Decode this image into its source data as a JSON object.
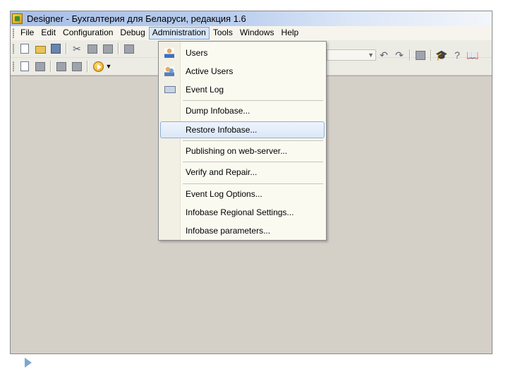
{
  "window": {
    "title": "Designer - Бухгалтерия для Беларуси, редакция 1.6",
    "app_icon": "1c-designer-icon"
  },
  "menubar": {
    "items": [
      {
        "label": "File"
      },
      {
        "label": "Edit"
      },
      {
        "label": "Configuration"
      },
      {
        "label": "Debug"
      },
      {
        "label": "Administration",
        "active": true
      },
      {
        "label": "Tools"
      },
      {
        "label": "Windows"
      },
      {
        "label": "Help"
      }
    ]
  },
  "administration_menu": {
    "items": [
      {
        "label": "Users",
        "icon": "user-icon"
      },
      {
        "label": "Active Users",
        "icon": "active-users-icon"
      },
      {
        "label": "Event Log",
        "icon": "event-log-icon"
      },
      {
        "label": "Dump Infobase..."
      },
      {
        "label": "Restore Infobase...",
        "highlighted": true
      },
      {
        "label": "Publishing on web-server..."
      },
      {
        "label": "Verify and Repair..."
      },
      {
        "label": "Event Log Options..."
      },
      {
        "label": "Infobase Regional Settings..."
      },
      {
        "label": "Infobase parameters..."
      }
    ]
  },
  "colors": {
    "titlebar": "#a9bfe6",
    "menu_background": "#fbfaf1",
    "highlight": "#dbe8f8",
    "workspace": "#d4d0c8",
    "slide_marker": "#7fa6cf"
  }
}
